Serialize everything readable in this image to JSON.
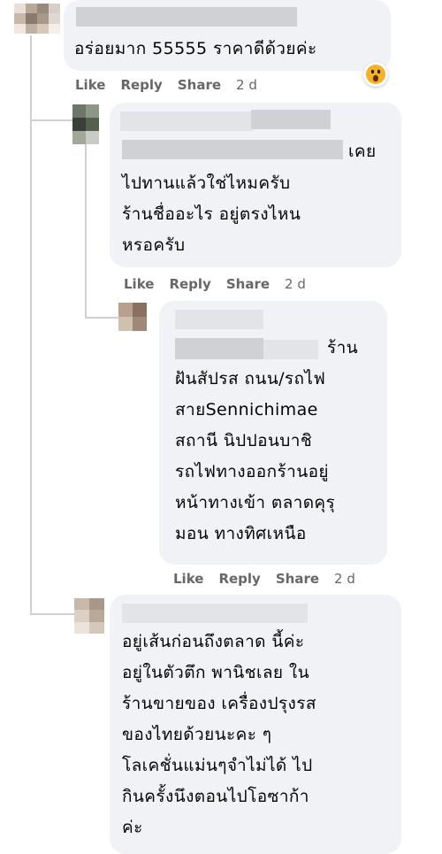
{
  "comments": [
    {
      "text": "อร่อยมาก 55555 ราคาดีด้วยค่ะ",
      "actions": {
        "like": "Like",
        "reply": "Reply",
        "share": "Share",
        "time": "2 d"
      },
      "reaction": "wow-emoji-icon"
    },
    {
      "lines": [
        "เคย",
        "ไปทานแล้วใช่ไหมครับ",
        "ร้านชื่ออะไร อยู่ตรงไหน",
        "หรอครับ"
      ],
      "actions": {
        "like": "Like",
        "reply": "Reply",
        "share": "Share",
        "time": "2 d"
      }
    },
    {
      "lines": [
        "ร้าน",
        "ฝันสัปรส ถนน/รถไฟ",
        "สายSennichimae",
        "สถานี นิปปอนบาชิ",
        "รถไฟทางออกร้านอยู่",
        "หน้าทางเข้า ตลาดคุรุ",
        "มอน ทางทิศเหนือ"
      ],
      "actions": {
        "like": "Like",
        "reply": "Reply",
        "share": "Share",
        "time": "2 d"
      }
    },
    {
      "lines": [
        "อยู่เส้นก่อนถึงตลาด นี้ค่ะ",
        "อยู่ในตัวตึก พานิชเลย ใน",
        "ร้านขายของ เครื่องปรุงรส",
        "ของไทยด้วยนะคะ ๆ",
        "โลเคชั่นแม่นๆจำไม่ได้ ไป",
        "กินครั้งนึงตอนไปโอซาก้า",
        "ค่ะ"
      ]
    }
  ],
  "colors": {
    "bubble": "#f0f2f5",
    "meta": "#65676b",
    "text": "#050505",
    "line": "#ced0d4"
  }
}
